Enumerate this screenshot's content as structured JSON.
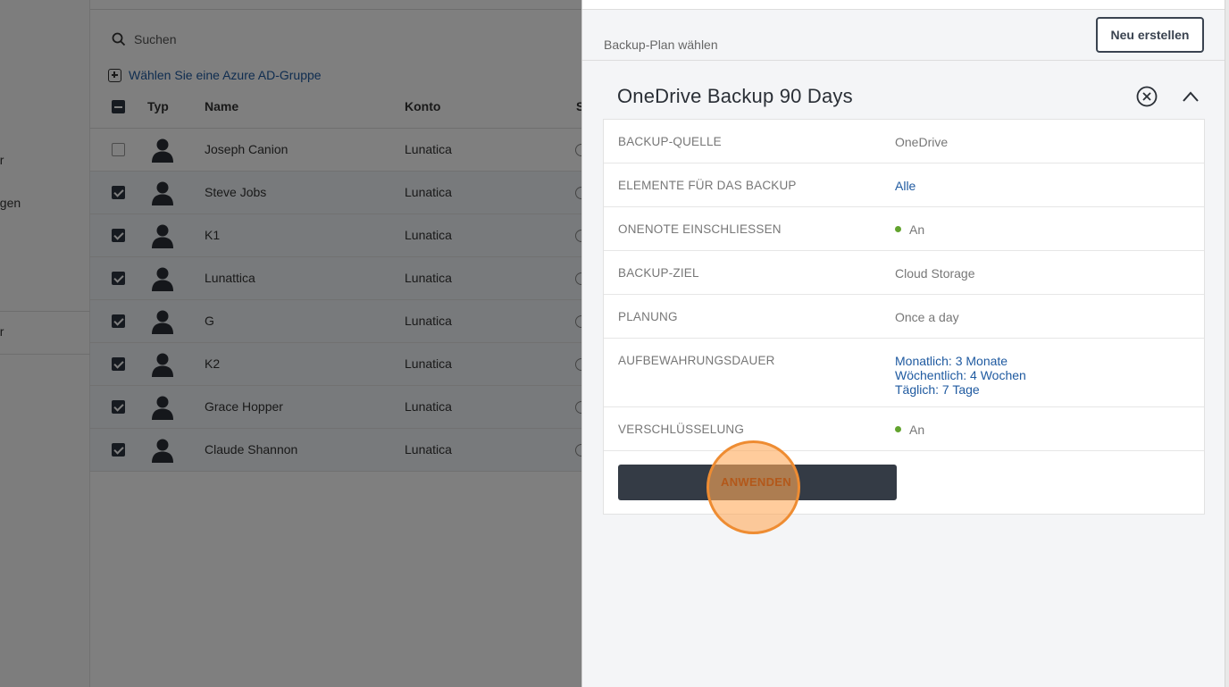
{
  "nav": {
    "items": [
      {
        "label": "er"
      },
      {
        "label": "ngen"
      },
      {
        "label": "er"
      }
    ]
  },
  "toolbar": {
    "search_label": "Suchen",
    "group_link": "Wählen Sie eine Azure AD-Gruppe"
  },
  "table": {
    "headers": {
      "typ": "Typ",
      "name": "Name",
      "konto": "Konto",
      "s": "S"
    },
    "rows": [
      {
        "name": "Joseph Canion",
        "konto": "Lunatica",
        "checked": false
      },
      {
        "name": "Steve Jobs",
        "konto": "Lunatica",
        "checked": true
      },
      {
        "name": "K1",
        "konto": "Lunatica",
        "checked": true
      },
      {
        "name": "Lunattica",
        "konto": "Lunatica",
        "checked": true
      },
      {
        "name": "G",
        "konto": "Lunatica",
        "checked": true
      },
      {
        "name": "K2",
        "konto": "Lunatica",
        "checked": true
      },
      {
        "name": "Grace Hopper",
        "konto": "Lunatica",
        "checked": true
      },
      {
        "name": "Claude Shannon",
        "konto": "Lunatica",
        "checked": true
      }
    ]
  },
  "panel": {
    "subtitle": "Backup-Plan wählen",
    "new_button": "Neu erstellen",
    "plan_title": "OneDrive Backup 90 Days",
    "details": [
      {
        "label": "BACKUP-QUELLE",
        "value": "OneDrive"
      },
      {
        "label": "ELEMENTE FÜR DAS BACKUP",
        "value": "Alle"
      },
      {
        "label": "ONENOTE EINSCHLIESSEN",
        "value": "An"
      },
      {
        "label": "BACKUP-ZIEL",
        "value": "Cloud Storage"
      },
      {
        "label": "PLANUNG",
        "value": "Once a day"
      },
      {
        "label": "AUFBEWAHRUNGSDAUER",
        "values": [
          "Monatlich: 3 Monate",
          "Wöchentlich: 4 Wochen",
          "Täglich: 7 Tage"
        ]
      },
      {
        "label": "VERSCHLÜSSELUNG",
        "value": "An"
      }
    ],
    "apply_button": "ANWENDEN"
  },
  "colors": {
    "accent_link": "#1f5aa0",
    "status_on": "#62a32e",
    "button_dark": "#343b45",
    "highlight": "#ee8c32"
  }
}
